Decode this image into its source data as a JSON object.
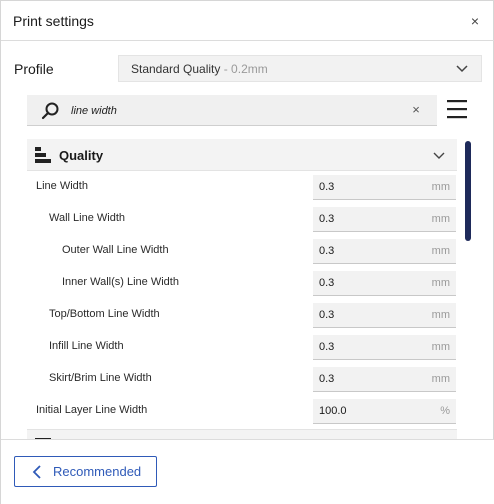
{
  "window": {
    "title": "Print settings",
    "close_glyph": "×"
  },
  "profile": {
    "label": "Profile",
    "selected": "Standard Quality",
    "selected_suffix": " - 0.2mm"
  },
  "search": {
    "value": "line width",
    "clear_glyph": "×"
  },
  "category": {
    "title": "Quality"
  },
  "settings": [
    {
      "label": "Line Width",
      "value": "0.3",
      "unit": "mm",
      "indent": 0
    },
    {
      "label": "Wall Line Width",
      "value": "0.3",
      "unit": "mm",
      "indent": 1
    },
    {
      "label": "Outer Wall Line Width",
      "value": "0.3",
      "unit": "mm",
      "indent": 2
    },
    {
      "label": "Inner Wall(s) Line Width",
      "value": "0.3",
      "unit": "mm",
      "indent": 2
    },
    {
      "label": "Top/Bottom Line Width",
      "value": "0.3",
      "unit": "mm",
      "indent": 1
    },
    {
      "label": "Infill Line Width",
      "value": "0.3",
      "unit": "mm",
      "indent": 1
    },
    {
      "label": "Skirt/Brim Line Width",
      "value": "0.3",
      "unit": "mm",
      "indent": 1
    },
    {
      "label": "Initial Layer Line Width",
      "value": "100.0",
      "unit": "%",
      "indent": 0
    }
  ],
  "footer": {
    "recommended_label": "Recommended"
  },
  "colors": {
    "accent": "#2f5ab8",
    "scrollbar": "#1e2a5a"
  },
  "icons": {
    "search": "search-icon",
    "menu": "hamburger-menu-icon",
    "quality": "quality-layers-icon",
    "back": "chevron-left-icon"
  }
}
